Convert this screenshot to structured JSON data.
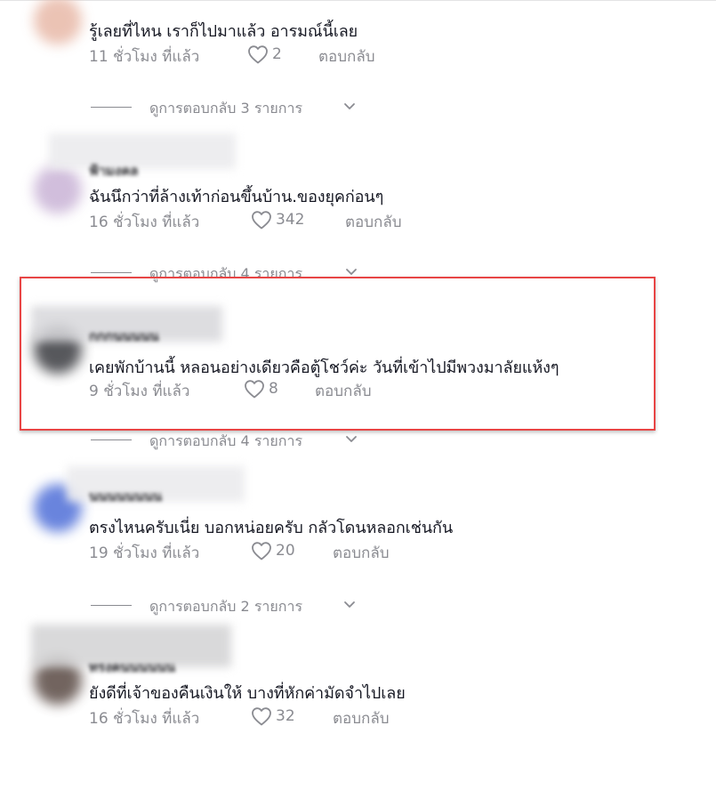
{
  "comments": [
    {
      "username": "",
      "text": "รู้เลยที่ไหน เราก็ไปมาแล้ว อารมณ์นี้เลย",
      "time": "11 ชั่วโมง ที่แล้ว",
      "likes": "2",
      "reply_label": "ตอบกลับ",
      "view_replies": "ดูการตอบกลับ 3 รายการ",
      "avatar_color": "#e8b9a8"
    },
    {
      "username": "ฟ้ามงคล",
      "text": "ฉันนึกว่าที่ล้างเท้าก่อนขึ้นบ้าน.ของยุคก่อนๆ",
      "time": "16 ชั่วโมง ที่แล้ว",
      "likes": "342",
      "reply_label": "ตอบกลับ",
      "view_replies": "ดูการตอบกลับ 4 รายการ",
      "avatar_color": "#c9b3d6"
    },
    {
      "username": "กกกนนนนน",
      "text": "เคยพักบ้านนี้ หลอนอย่างเดียวคือตู้โชว์ค่ะ วันที่เข้าไปมีพวงมาลัยแห้งๆ",
      "time": "9 ชั่วโมง ที่แล้ว",
      "likes": "8",
      "reply_label": "ตอบกลับ",
      "view_replies": "ดูการตอบกลับ 4 รายการ",
      "avatar_color": "#3a3b40"
    },
    {
      "username": "นนนนนนนน",
      "text": "ตรงไหนครับเนี่ย บอกหน่อยครับ กลัวโดนหลอกเช่นกัน",
      "time": "19 ชั่วโมง ที่แล้ว",
      "likes": "20",
      "reply_label": "ตอบกลับ",
      "view_replies": "ดูการตอบกลับ 2 รายการ",
      "avatar_color": "#4f6fd8"
    },
    {
      "username": "ทรงคนนนนนน",
      "text": "ยังดีที่เจ้าของคืนเงินให้ บางที่หักค่ามัดจำไปเลย",
      "time": "16 ชั่วโมง ที่แล้ว",
      "likes": "32",
      "reply_label": "ตอบกลับ",
      "view_replies": "",
      "avatar_color": "#5a4a44"
    }
  ],
  "highlight_color": "#e84545"
}
